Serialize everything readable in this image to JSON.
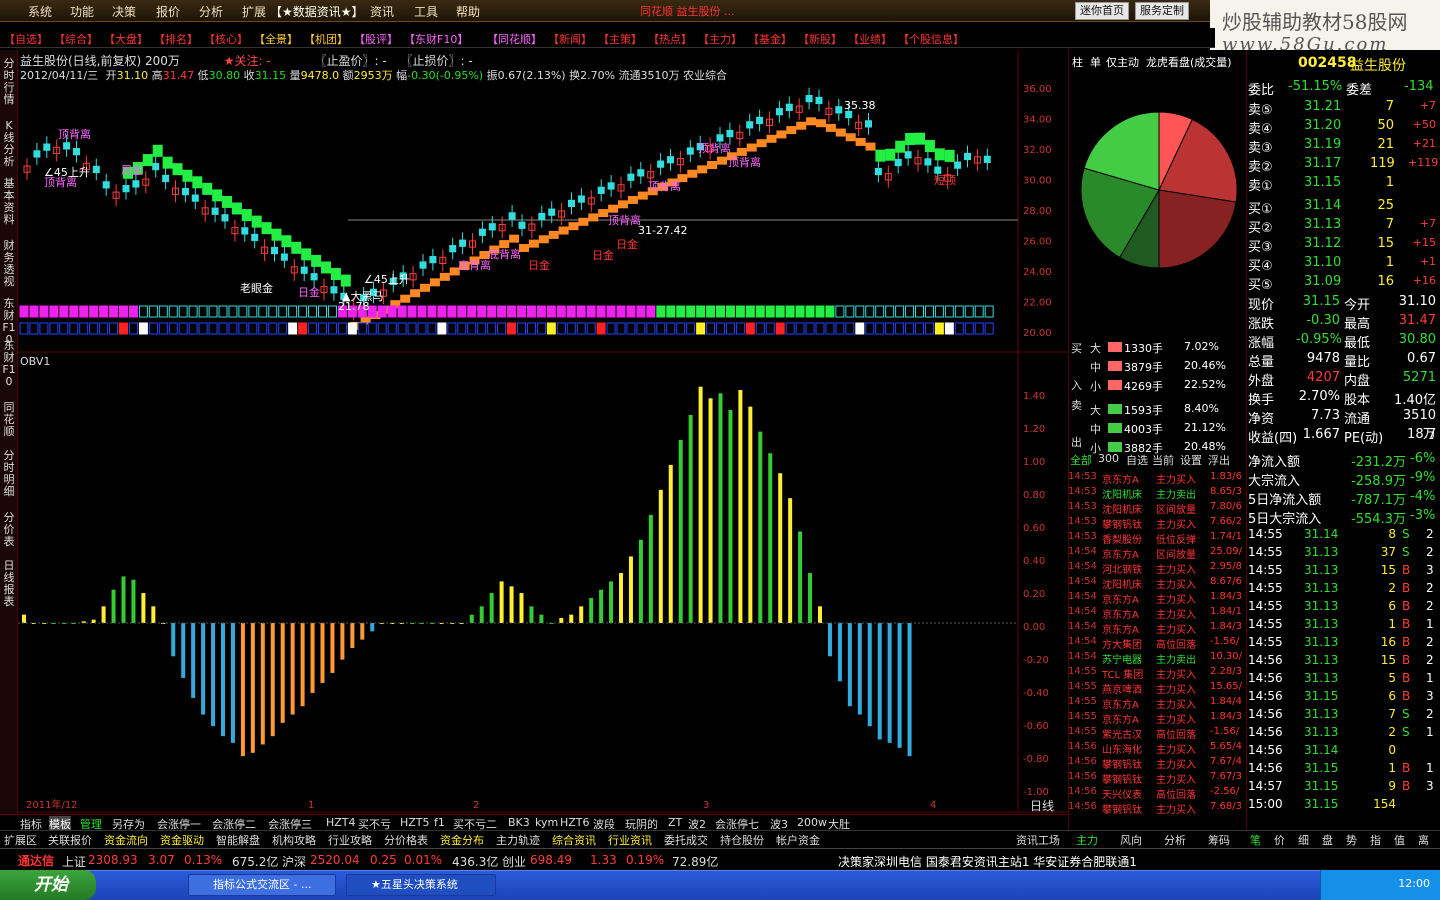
{
  "menu": {
    "items": [
      "系统",
      "功能",
      "决策",
      "报价",
      "分析",
      "扩展",
      "【★数据资讯★】",
      "资讯",
      "工具",
      "帮助"
    ],
    "marquee": "同花顺 益生股份 ...",
    "buttons": [
      "迷你首页",
      "服务定制"
    ]
  },
  "watermark": {
    "line1": "炒股辅助教材58股网",
    "line2": "www.58Gu.com"
  },
  "quickbar": {
    "items": [
      "【自选】",
      "【综合】",
      "【大盘】",
      "【排名】",
      "【核心】",
      "【全景】",
      "【机团】",
      "【股评】",
      "【东财F10】",
      "【同花顺】",
      "【新闻】",
      "【主策】",
      "【热点】",
      "【主力】",
      "【基金】",
      "【新股】",
      "【业绩】",
      "【个股信息】"
    ]
  },
  "leftbar": {
    "tabs": [
      "分时行情",
      "K线分析",
      "基本资料",
      "财务透视",
      "东财F10",
      "东财F10",
      "同花顺",
      "分时明细",
      "分价表",
      "日线报表"
    ]
  },
  "chart": {
    "stock": "益生股份(日线,前复权) 200万",
    "focus": "★关注: -",
    "stoploss": "〖止盈价〗: -",
    "stopprice": "〖止损价〗: -",
    "date": "2012/04/11/三",
    "open_l": "开",
    "open": "31.10",
    "high_l": "高",
    "high": "31.47",
    "low_l": "低",
    "low": "30.80",
    "close_l": "收",
    "close": "31.15",
    "vol_l": "量",
    "vol": "9478.0",
    "amt_l": "额",
    "amt": "2953万",
    "chg_l": "幅",
    "chg": "-0.30(-0.95%)",
    "amp": "振0.67(2.13%)",
    "turn": "换2.70%",
    "float": "流通3510万",
    "ind": "农业综合",
    "indicator": "OBV1",
    "annotations": {
      "a1": "顶背离",
      "a2": "顶背离",
      "a3": "∠45上升",
      "a4": "周金",
      "a5": "老眼金",
      "a6": "日金",
      "a7": "▲大黑马",
      "a8": "∠45上升",
      "a9": "底背离",
      "a10": "底背离",
      "a11": "日金",
      "a12": "日金",
      "a13": "顶背离",
      "a14": "日金",
      "a15": "顶背离",
      "a16": "顶背离",
      "a17": "短顶",
      "a18": "35.38",
      "a19": "21.78",
      "a20": "31-27.42",
      "a21": "顶背离"
    },
    "price_axis": [
      "36.00",
      "34.00",
      "32.00",
      "30.00",
      "28.00",
      "26.00",
      "24.00",
      "22.00",
      "20.00"
    ],
    "obv_axis": [
      "1.40",
      "1.20",
      "1.00",
      "0.80",
      "0.60",
      "0.40",
      "0.20",
      "0.00",
      "-0.20",
      "-0.40",
      "-0.60",
      "-0.80",
      "-1.00"
    ],
    "date_axis": [
      "2011年/12",
      "1",
      "2",
      "3",
      "4"
    ],
    "period": "日线"
  },
  "bottomtabs": {
    "items": [
      "指标",
      "模板",
      "管理",
      "另存为",
      "会涨停一",
      "会涨停二",
      "会涨停三",
      "HZT4",
      "买不亏",
      "HZT5",
      "f1",
      "买不亏二",
      "BK3",
      "kym",
      "HZT6",
      "波段",
      "玩阴的",
      "ZT",
      "波2",
      "会涨停七",
      "波3",
      "200w",
      "大肚"
    ]
  },
  "bottomtabs2": {
    "items": [
      "扩展区",
      "关联报价",
      "资金流向",
      "资金驱动",
      "智能解盘",
      "机构攻略",
      "行业攻略",
      "分价格表",
      "资金分布",
      "主力轨迹",
      "综合资讯",
      "行业资讯",
      "委托成交",
      "持仓股份",
      "帐户资金"
    ],
    "right": [
      "资讯工场",
      "主力",
      "风向",
      "分析",
      "筹码"
    ],
    "far": [
      "笔",
      "价",
      "细",
      "盘",
      "势",
      "指",
      "值",
      "离"
    ]
  },
  "statusbar": {
    "brand": "通达信",
    "sh_l": "上证",
    "sh": "2308.93",
    "sh_c": "3.07",
    "sh_p": "0.13%",
    "sh_a": "675.2亿",
    "sz_l": "沪深",
    "sz": "2520.04",
    "sz_c": "0.25",
    "sz_p": "0.01%",
    "sz_a": "436.3亿",
    "cy_l": "创业",
    "cy": "698.49",
    "cy_c": "1.33",
    "cy_p": "0.19%",
    "cy_a": "72.89亿",
    "news": "决策家深圳电信  国泰君安资讯主站1  华安证券合肥联通1"
  },
  "taskbar": {
    "start": "开始",
    "tasks": [
      "指标公式交流区 - ...",
      "★五星头决策系统"
    ],
    "clock": "12:00"
  },
  "rightpanel": {
    "tabs": [
      "柱",
      "单",
      "仅主动",
      "龙虎看盘(成交量)"
    ],
    "buy_l": "买",
    "sell_l": "卖",
    "in_l": "入",
    "out_l": "出",
    "flow": [
      {
        "k": "大",
        "v": "1330手",
        "p": "7.02%"
      },
      {
        "k": "中",
        "v": "3879手",
        "p": "20.46%"
      },
      {
        "k": "小",
        "v": "4269手",
        "p": "22.52%"
      },
      {
        "k": "大",
        "v": "1593手",
        "p": "8.40%"
      },
      {
        "k": "中",
        "v": "4003手",
        "p": "21.12%"
      },
      {
        "k": "小",
        "v": "3882手",
        "p": "20.48%"
      }
    ],
    "filters": [
      "全部",
      "300",
      "自选",
      "当前",
      "设置",
      "浮出"
    ],
    "news": [
      [
        "14:53",
        "京东方A",
        "主力买入",
        "1.83/6"
      ],
      [
        "14:53",
        "沈阳机床",
        "主力卖出",
        "8.65/3"
      ],
      [
        "14:53",
        "沈阳机床",
        "区间放量",
        "7.80/6"
      ],
      [
        "14:53",
        "攀钢钒钛",
        "主力买入",
        "7.66/2"
      ],
      [
        "14:53",
        "香梨股份",
        "低位反弹",
        "1.74/1"
      ],
      [
        "14:54",
        "京东方A",
        "区间放量",
        "25.09/"
      ],
      [
        "14:54",
        "河北钢铁",
        "主力买入",
        "2.95/8"
      ],
      [
        "14:54",
        "沈阳机床",
        "主力买入",
        "8.67/6"
      ],
      [
        "14:54",
        "京东方A",
        "主力买入",
        "1.84/3"
      ],
      [
        "14:54",
        "京东方A",
        "主力买入",
        "1.84/1"
      ],
      [
        "14:54",
        "京东方A",
        "主力买入",
        "1.84/3"
      ],
      [
        "14:54",
        "方大集团",
        "高位回落",
        "-1.56/"
      ],
      [
        "14:54",
        "苏宁电器",
        "主力卖出",
        "10.30/"
      ],
      [
        "14:55",
        "TCL 集团",
        "主力买入",
        "2.28/3"
      ],
      [
        "14:55",
        "燕京啤酒",
        "主力买入",
        "15.65/"
      ],
      [
        "14:55",
        "京东方A",
        "主力买入",
        "1.84/4"
      ],
      [
        "14:55",
        "京东方A",
        "主力买入",
        "1.84/3"
      ],
      [
        "14:55",
        "紫光古汉",
        "高位回落",
        "-1.56/"
      ],
      [
        "14:56",
        "山东海化",
        "主力买入",
        "5.65/4"
      ],
      [
        "14:56",
        "攀钢钒钛",
        "主力买入",
        "7.67/4"
      ],
      [
        "14:56",
        "攀钢钒钛",
        "主力买入",
        "7.67/3"
      ],
      [
        "14:56",
        "天兴仪表",
        "高位回落",
        "-2.56/"
      ],
      [
        "14:56",
        "攀钢钒钛",
        "主力买入",
        "7.68/3"
      ]
    ]
  },
  "quote": {
    "code": "002458",
    "name": "益生股份",
    "weibi_l": "委比",
    "weibi": "-51.15%",
    "weicha_l": "委差",
    "weicha": "-134",
    "asks": [
      [
        "卖⑤",
        "31.21",
        "7",
        "+7"
      ],
      [
        "卖④",
        "31.20",
        "50",
        "+50"
      ],
      [
        "卖③",
        "31.19",
        "21",
        "+21"
      ],
      [
        "卖②",
        "31.17",
        "119",
        "+119"
      ],
      [
        "卖①",
        "31.15",
        "1",
        ""
      ]
    ],
    "bids": [
      [
        "买①",
        "31.14",
        "25",
        ""
      ],
      [
        "买②",
        "31.13",
        "7",
        "+7"
      ],
      [
        "买③",
        "31.12",
        "15",
        "+15"
      ],
      [
        "买④",
        "31.10",
        "1",
        "+1"
      ],
      [
        "买⑤",
        "31.09",
        "16",
        "+16"
      ]
    ],
    "stats": [
      [
        "现价",
        "31.15",
        "今开",
        "31.10"
      ],
      [
        "涨跌",
        "-0.30",
        "最高",
        "31.47"
      ],
      [
        "涨幅",
        "-0.95%",
        "最低",
        "30.80"
      ],
      [
        "总量",
        "9478",
        "量比",
        "0.67"
      ],
      [
        "外盘",
        "4207",
        "内盘",
        "5271"
      ],
      [
        "换手",
        "2.70%",
        "股本",
        "1.40亿"
      ],
      [
        "净资",
        "7.73",
        "流通",
        "3510万"
      ],
      [
        "收益(四)",
        "1.667",
        "PE(动)",
        "18.7"
      ]
    ],
    "flows": [
      [
        "净流入额",
        "-231.2万",
        "-6%"
      ],
      [
        "大宗流入",
        "-258.9万",
        "-9%"
      ],
      [
        "5日净流入额",
        "-787.1万",
        "-4%"
      ],
      [
        "5日大宗流入",
        "-554.3万",
        "-3%"
      ]
    ],
    "ticks": [
      [
        "14:55",
        "31.14",
        "8",
        "S",
        "2"
      ],
      [
        "14:55",
        "31.13",
        "37",
        "S",
        "2"
      ],
      [
        "14:55",
        "31.13",
        "15",
        "B",
        "3"
      ],
      [
        "14:55",
        "31.13",
        "2",
        "B",
        "2"
      ],
      [
        "14:55",
        "31.13",
        "6",
        "B",
        "2"
      ],
      [
        "14:55",
        "31.13",
        "1",
        "B",
        "1"
      ],
      [
        "14:55",
        "31.13",
        "16",
        "B",
        "2"
      ],
      [
        "14:56",
        "31.13",
        "15",
        "B",
        "2"
      ],
      [
        "14:56",
        "31.13",
        "5",
        "B",
        "1"
      ],
      [
        "14:56",
        "31.15",
        "6",
        "B",
        "3"
      ],
      [
        "14:56",
        "31.13",
        "7",
        "S",
        "2"
      ],
      [
        "14:56",
        "31.13",
        "2",
        "S",
        "1"
      ],
      [
        "14:56",
        "31.14",
        "0",
        "",
        ""
      ],
      [
        "14:56",
        "31.15",
        "1",
        "B",
        "1"
      ],
      [
        "14:57",
        "31.15",
        "9",
        "B",
        "3"
      ],
      [
        "15:00",
        "31.15",
        "154",
        "",
        ""
      ]
    ]
  },
  "chart_data": {
    "type": "bar",
    "title": "OBV1",
    "series": [
      {
        "name": "OBV1",
        "values": [
          0.05,
          0.0,
          0.0,
          0.0,
          0.0,
          0.0,
          0.01,
          0.02,
          0.1,
          0.2,
          0.28,
          0.26,
          0.18,
          0.1,
          0.0,
          -0.2,
          -0.33,
          -0.45,
          -0.55,
          -0.62,
          -0.68,
          -0.72,
          -0.8,
          -0.78,
          -0.73,
          -0.68,
          -0.6,
          -0.55,
          -0.5,
          -0.42,
          -0.36,
          -0.3,
          -0.22,
          -0.15,
          -0.1,
          -0.05,
          0.0,
          0.0,
          0.0,
          0.0,
          0.0,
          0.0,
          0.0,
          0.0,
          0.0,
          0.05,
          0.1,
          0.18,
          0.25,
          0.22,
          0.18,
          0.1,
          0.05,
          0.0,
          0.03,
          0.05,
          0.1,
          0.15,
          0.2,
          0.25,
          0.3,
          0.4,
          0.5,
          0.65,
          0.8,
          0.95,
          1.1,
          1.25,
          1.42,
          1.35,
          1.38,
          1.28,
          1.4,
          1.3,
          1.15,
          1.02,
          0.9,
          0.75,
          0.55,
          0.3,
          0.1,
          -0.2,
          -0.35,
          -0.5,
          -0.55,
          -0.62,
          -0.7,
          -0.72,
          -0.75,
          -0.8
        ]
      }
    ],
    "ylim": [
      -1.0,
      1.4
    ]
  }
}
